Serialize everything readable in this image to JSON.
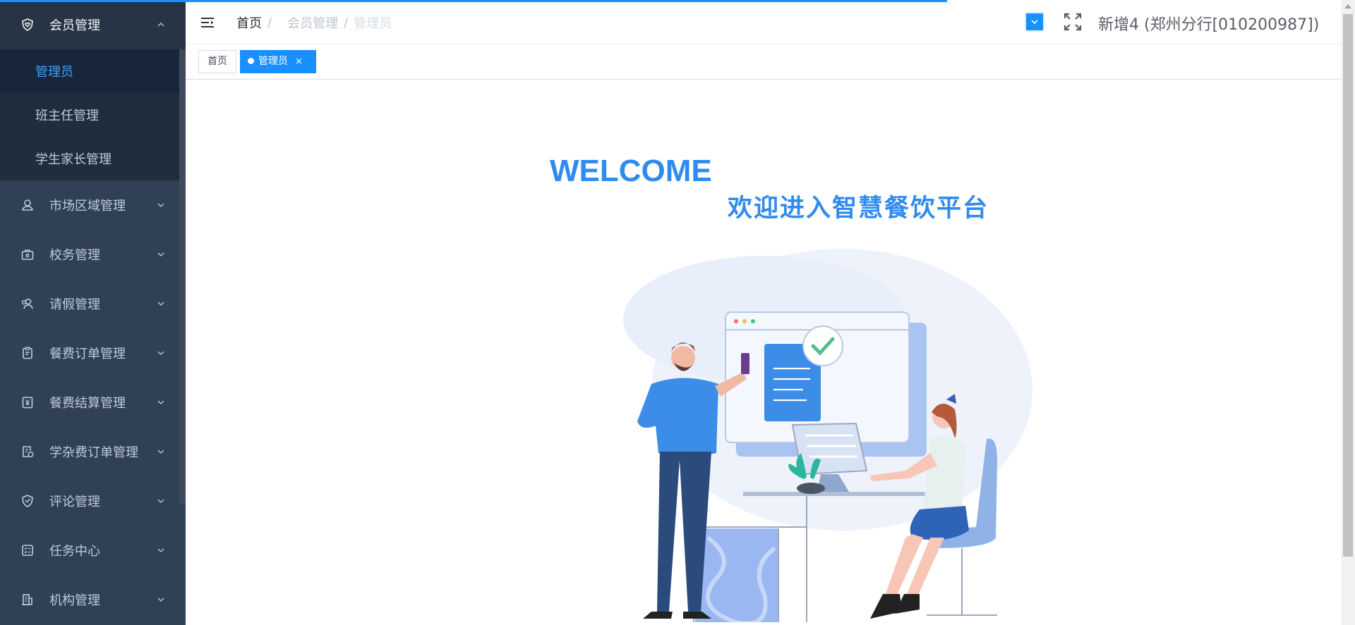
{
  "sidebar": {
    "groups": [
      {
        "label": "会员管理",
        "icon": "shield-heart-icon",
        "open": true,
        "items": [
          {
            "label": "管理员",
            "active": true
          },
          {
            "label": "班主任管理",
            "active": false
          },
          {
            "label": "学生家长管理",
            "active": false
          }
        ]
      },
      {
        "label": "市场区域管理",
        "icon": "location-person-icon"
      },
      {
        "label": "校务管理",
        "icon": "briefcase-icon"
      },
      {
        "label": "请假管理",
        "icon": "user-search-icon"
      },
      {
        "label": "餐费订单管理",
        "icon": "clipboard-icon"
      },
      {
        "label": "餐费结算管理",
        "icon": "yen-document-icon"
      },
      {
        "label": "学杂费订单管理",
        "icon": "document-clock-icon"
      },
      {
        "label": "评论管理",
        "icon": "shield-comment-icon"
      },
      {
        "label": "任务中心",
        "icon": "checklist-icon"
      },
      {
        "label": "机构管理",
        "icon": "building-icon"
      }
    ]
  },
  "header": {
    "breadcrumb": [
      "首页",
      "会员管理",
      "管理员"
    ],
    "breadcrumb_sep": "/",
    "user": "新增4 (郑州分行[010200987])"
  },
  "tags": {
    "home": "首页",
    "active": "管理员",
    "close": "×"
  },
  "main": {
    "welcome_en": "WELCOME",
    "welcome_cn": "欢迎进入智慧餐饮平台"
  },
  "colors": {
    "accent": "#1890ff",
    "sidebar_bg": "#304156",
    "welcome": "#2f8bef"
  }
}
